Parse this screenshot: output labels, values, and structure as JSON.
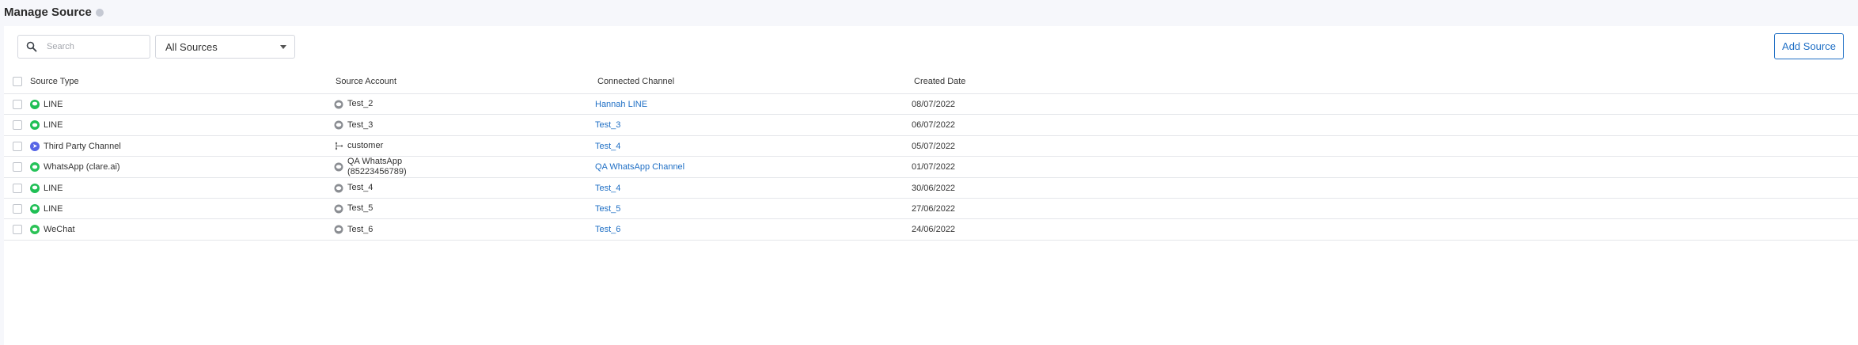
{
  "page": {
    "title": "Manage Source"
  },
  "toolbar": {
    "search_placeholder": "Search",
    "filter_value": "All Sources",
    "add_button_label": "Add Source"
  },
  "colors": {
    "accent": "#1f6fc5",
    "line": "#1fbf55",
    "whatsapp": "#25c35a",
    "wechat": "#2bc256",
    "third_party": "#5665e6"
  },
  "table": {
    "headers": {
      "source_type": "Source Type",
      "source_account": "Source Account",
      "connected_channel": "Connected Channel",
      "created_date": "Created Date"
    },
    "rows": [
      {
        "type": "LINE",
        "type_icon": "line-icon",
        "account": "Test_2",
        "account_icon": "chat-bubble-icon",
        "channel": "Hannah LINE",
        "date": "08/07/2022"
      },
      {
        "type": "LINE",
        "type_icon": "line-icon",
        "account": "Test_3",
        "account_icon": "chat-bubble-icon",
        "channel": "Test_3",
        "date": "06/07/2022"
      },
      {
        "type": "Third Party Channel",
        "type_icon": "send-icon",
        "account": "customer",
        "account_icon": "branch-icon",
        "channel": "Test_4",
        "date": "05/07/2022"
      },
      {
        "type": "WhatsApp (clare.ai)",
        "type_icon": "whatsapp-icon",
        "account": "QA WhatsApp",
        "account_line2": "(85223456789)",
        "account_icon": "whatsapp-outline-icon",
        "channel": "QA WhatsApp Channel",
        "date": "01/07/2022"
      },
      {
        "type": "LINE",
        "type_icon": "line-icon",
        "account": "Test_4",
        "account_icon": "chat-bubble-icon",
        "channel": "Test_4",
        "date": "30/06/2022"
      },
      {
        "type": "LINE",
        "type_icon": "line-icon",
        "account": "Test_5",
        "account_icon": "chat-bubble-icon",
        "channel": "Test_5",
        "date": "27/06/2022"
      },
      {
        "type": "WeChat",
        "type_icon": "wechat-icon",
        "account": "Test_6",
        "account_icon": "wechat-outline-icon",
        "channel": "Test_6",
        "date": "24/06/2022"
      }
    ]
  }
}
